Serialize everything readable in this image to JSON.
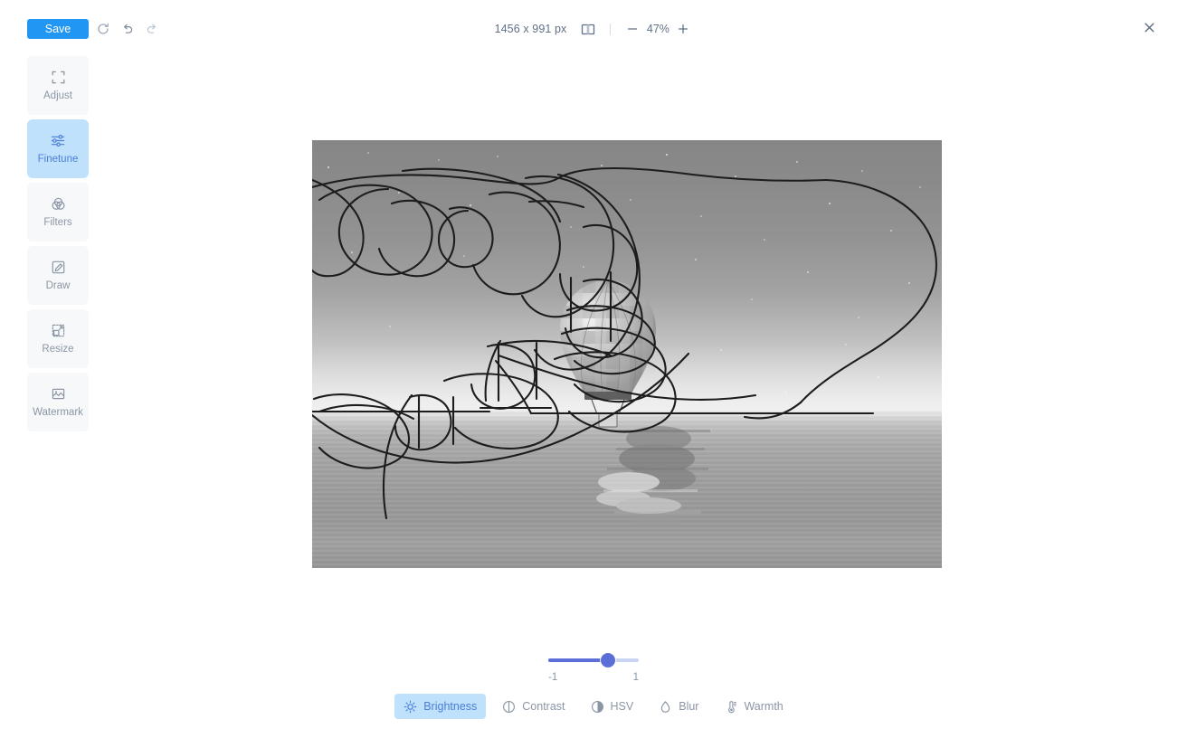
{
  "header": {
    "save_label": "Save",
    "dimensions": "1456 x 991 px",
    "zoom_level": "47%",
    "icons": {
      "reset": "reset-icon",
      "undo": "undo-icon",
      "redo": "redo-icon",
      "compare": "compare-view-icon",
      "zoom_out": "minus-icon",
      "zoom_in": "plus-icon",
      "close": "close-icon"
    }
  },
  "sidebar": {
    "items": [
      {
        "label": "Adjust",
        "icon": "crop-icon",
        "active": false
      },
      {
        "label": "Finetune",
        "icon": "sliders-icon",
        "active": true
      },
      {
        "label": "Filters",
        "icon": "filters-icon",
        "active": false
      },
      {
        "label": "Draw",
        "icon": "pencil-icon",
        "active": false
      },
      {
        "label": "Resize",
        "icon": "resize-icon",
        "active": false
      },
      {
        "label": "Watermark",
        "icon": "image-icon",
        "active": false
      }
    ]
  },
  "canvas": {
    "image_description": "Grayscale photo of a hot air balloon over water at dusk with stars, overlaid with black freehand scribble loops",
    "balloon_alt": "hot air balloon",
    "reflection_alt": "balloon reflection on water"
  },
  "slider": {
    "min_label": "-1",
    "max_label": "1",
    "value_percent": 66
  },
  "bottom_toolbar": {
    "tools": [
      {
        "label": "Brightness",
        "icon": "sun-icon",
        "active": true
      },
      {
        "label": "Contrast",
        "icon": "contrast-icon",
        "active": false
      },
      {
        "label": "HSV",
        "icon": "hsv-icon",
        "active": false
      },
      {
        "label": "Blur",
        "icon": "droplet-icon",
        "active": false
      },
      {
        "label": "Warmth",
        "icon": "thermometer-icon",
        "active": false
      }
    ]
  },
  "colors": {
    "accent": "#2196f3",
    "active_bg": "#bfe1fc",
    "active_text": "#4b7fd6",
    "slider": "#5c6fd8",
    "muted_text": "#8b96a5"
  }
}
